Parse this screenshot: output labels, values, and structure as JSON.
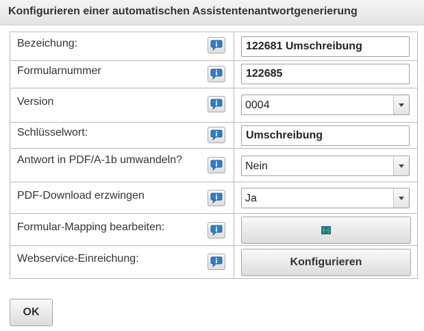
{
  "dialog": {
    "title": "Konfigurieren einer automatischen Assistentenantwortgenerierung"
  },
  "rows": [
    {
      "label": "Bezeichung:",
      "value": "122681 Umschreibung"
    },
    {
      "label": "Formularnummer",
      "value": "122685"
    },
    {
      "label": "Version",
      "value": "0004"
    },
    {
      "label": "Schlüsselwort:",
      "value": "Umschreibung"
    },
    {
      "label": "Antwort in PDF/A-1b umwandeln?",
      "value": "Nein"
    },
    {
      "label": "PDF-Download erzwingen",
      "value": "Ja"
    },
    {
      "label": "Formular-Mapping bearbeiten:",
      "button_icon": "mapping-h-icon"
    },
    {
      "label": "Webservice-Einreichung:",
      "button_label": "Konfigurieren"
    }
  ],
  "footer": {
    "ok_label": "OK"
  },
  "icons": {
    "info": "info-speech-bubble-icon"
  },
  "colors": {
    "info_blue": "#2a7fd4",
    "mapping_green": "#2fae3c"
  }
}
